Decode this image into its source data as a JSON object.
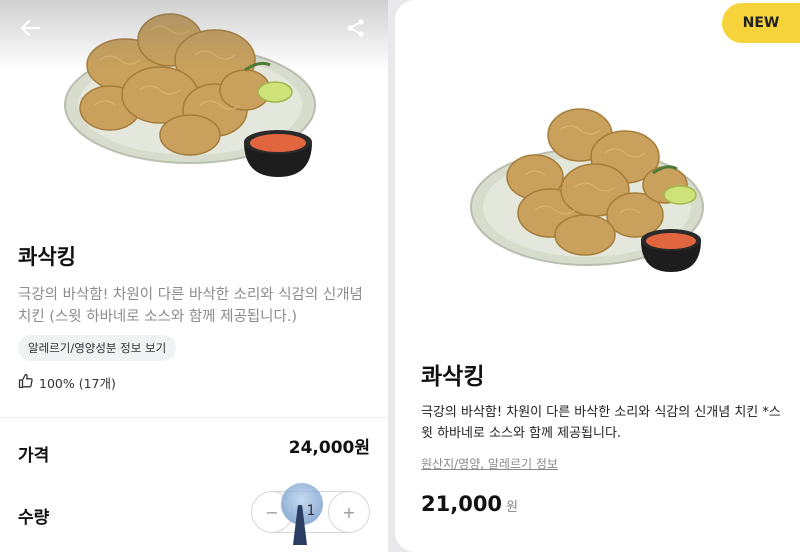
{
  "left": {
    "title": "콰삭킹",
    "description": "극강의 바삭함! 차원이 다른 바삭한 소리와 식감의 신개념 치킨 (스윗 하바네로 소스와 함께 제공됩니다.)",
    "info_chip": "알레르기/영양성분 정보 보기",
    "likes": "100% (17개)",
    "price_label": "가격",
    "price_value": "24,000원",
    "quantity_label": "수량",
    "quantity_value": "1",
    "minus_symbol": "−",
    "plus_symbol": "+",
    "icons": [
      "back-arrow-icon",
      "share-icon",
      "thumbs-up-icon"
    ]
  },
  "right": {
    "badge": "NEW",
    "title": "콰삭킹",
    "description": "극강의 바삭함! 차원이 다른 바삭한 소리와 식감의 신개념 치킨 *스윗 하바네로 소스와 함께 제공됩니다.",
    "info_link": "원산지/영양, 알레르기 정보",
    "price_number": "21,000",
    "price_unit": "원"
  },
  "colors": {
    "badge_yellow": "#f7d33b",
    "chip_bg": "#f1f2f4",
    "muted_text": "#8c8c8c"
  }
}
